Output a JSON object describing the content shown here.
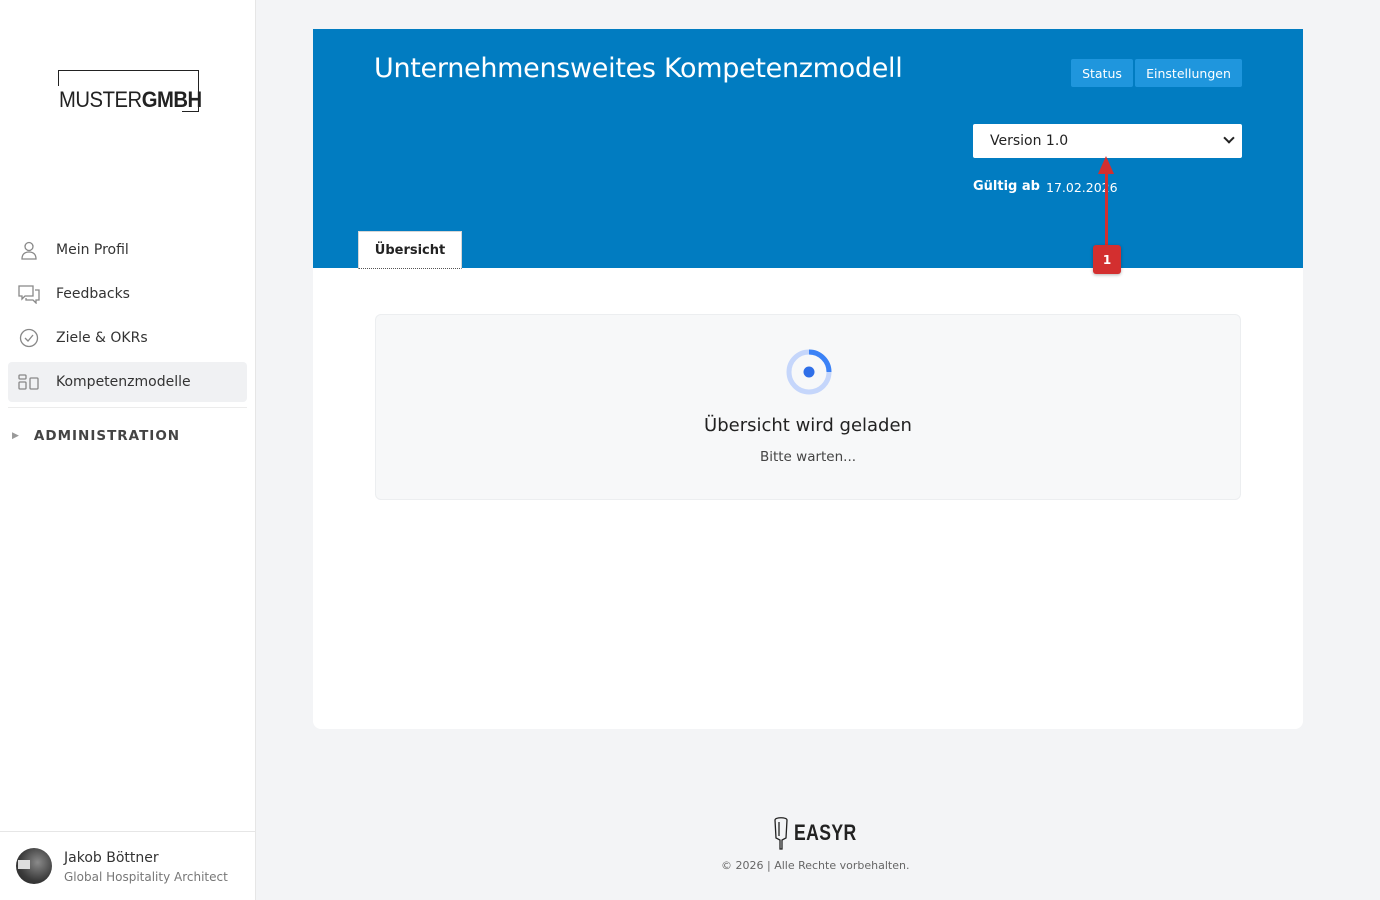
{
  "brand": {
    "logo_regular": "MUSTER",
    "logo_bold": "GMBH"
  },
  "sidebar": {
    "items": [
      {
        "label": "Mein Profil",
        "icon": "user-icon"
      },
      {
        "label": "Feedbacks",
        "icon": "chat-icon"
      },
      {
        "label": "Ziele & OKRs",
        "icon": "check-circle-icon"
      },
      {
        "label": "Kompetenzmodelle",
        "icon": "model-icon",
        "active": true
      }
    ],
    "admin_label": "ADMINISTRATION"
  },
  "user": {
    "name": "Jakob Böttner",
    "role": "Global Hospitality Architect"
  },
  "header": {
    "title": "Unternehmensweites Kompetenzmodell",
    "status_button": "Status",
    "settings_button": "Einstellungen",
    "version_select": "Version 1.0",
    "valid_label": "Gültig ab",
    "valid_date": "17.02.2026",
    "tab": "Übersicht"
  },
  "annotation": {
    "badge": "1",
    "color": "#d32f2f"
  },
  "loading": {
    "title": "Übersicht wird geladen",
    "subtitle": "Bitte warten..."
  },
  "footer": {
    "logo": "EASYR",
    "copyright": "© 2026 | Alle Rechte vorbehalten."
  },
  "colors": {
    "header_blue": "#017cc1",
    "button_blue": "#1f96dd"
  }
}
